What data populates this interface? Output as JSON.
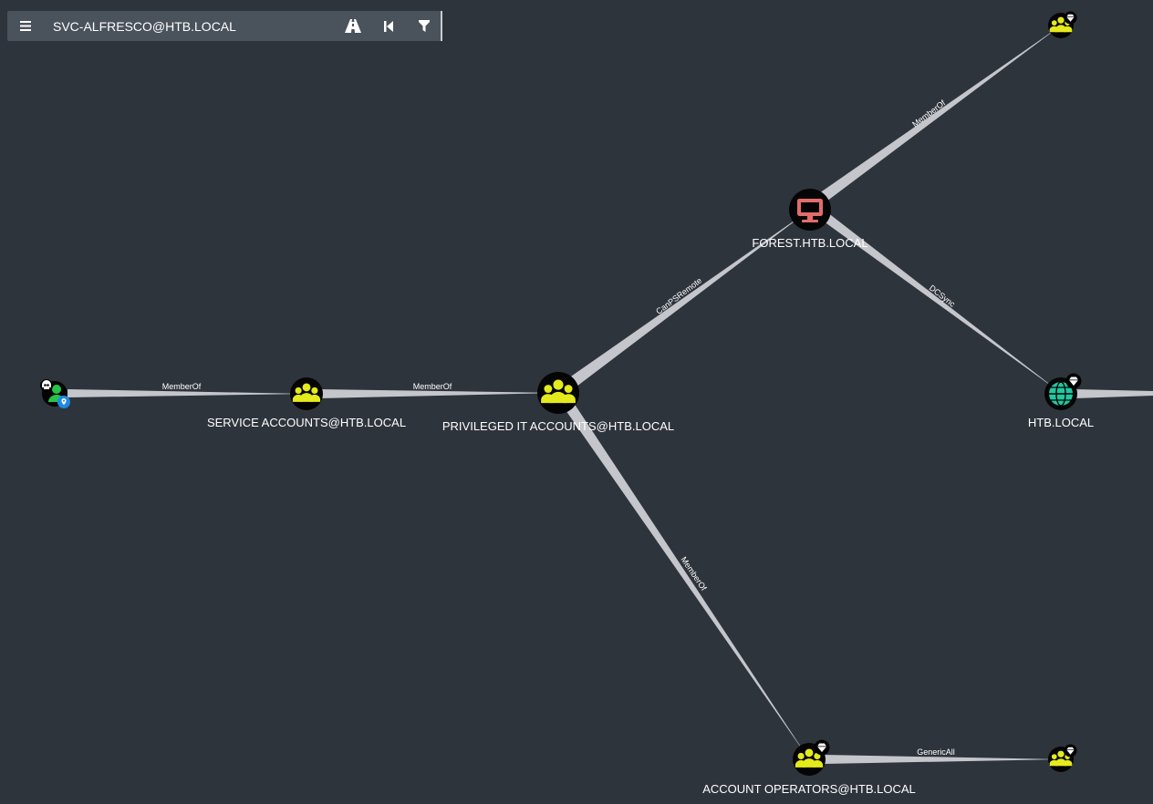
{
  "toolbar": {
    "search_value": "SVC-ALFRESCO@HTB.LOCAL",
    "icons": [
      "hamburger-menu-icon",
      "road-icon",
      "step-backward-icon",
      "filter-icon"
    ]
  },
  "nodes": {
    "svc_alfresco": {
      "label": "",
      "type": "user",
      "icons": [
        "skull-icon",
        "user-icon",
        "location-marker-icon"
      ]
    },
    "service_accounts": {
      "label": "SERVICE ACCOUNTS@HTB.LOCAL",
      "type": "group",
      "icons": [
        "group-icon"
      ]
    },
    "privileged_it": {
      "label": "PRIVILEGED IT ACCOUNTS@HTB.LOCAL",
      "type": "group",
      "icons": [
        "group-icon"
      ]
    },
    "forest": {
      "label": "FOREST.HTB.LOCAL",
      "type": "computer",
      "icons": [
        "monitor-icon"
      ]
    },
    "htb_local": {
      "label": "HTB.LOCAL",
      "type": "domain",
      "icons": [
        "globe-icon",
        "diamond-icon"
      ]
    },
    "account_operators": {
      "label": "ACCOUNT OPERATORS@HTB.LOCAL",
      "type": "group",
      "icons": [
        "group-icon",
        "diamond-icon"
      ]
    },
    "top_group": {
      "label": "",
      "type": "group",
      "icons": [
        "group-icon",
        "diamond-icon"
      ]
    },
    "bottom_group": {
      "label": "",
      "type": "group",
      "icons": [
        "group-icon",
        "diamond-icon"
      ]
    }
  },
  "edges": {
    "e1": "MemberOf",
    "e2": "MemberOf",
    "e3": "CanPSRemote",
    "e4": "MemberOf",
    "e5": "DCSync",
    "e6": "MemberOf",
    "e7": "GenericAll"
  },
  "colors": {
    "background": "#2e343c",
    "toolbar": "#4a525c",
    "edge": "#c4c6cc",
    "group": "#e4ea1c",
    "user": "#25c449",
    "computer": "#e26d6b",
    "domain": "#1fc9a2",
    "node_bg": "#050505"
  }
}
